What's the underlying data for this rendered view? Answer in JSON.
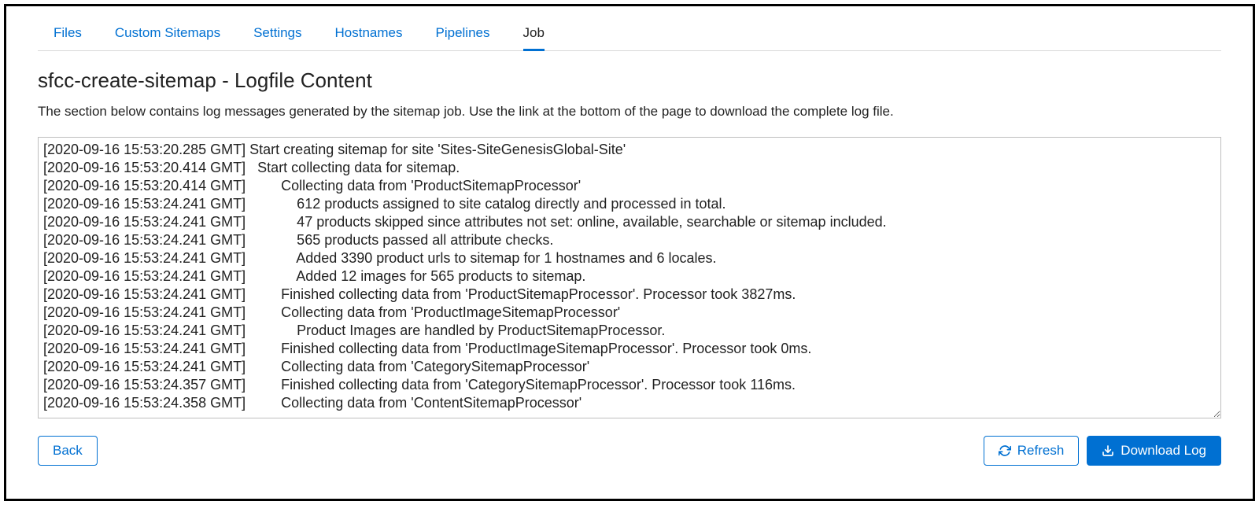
{
  "tabs": [
    {
      "label": "Files",
      "active": false
    },
    {
      "label": "Custom Sitemaps",
      "active": false
    },
    {
      "label": "Settings",
      "active": false
    },
    {
      "label": "Hostnames",
      "active": false
    },
    {
      "label": "Pipelines",
      "active": false
    },
    {
      "label": "Job",
      "active": true
    }
  ],
  "page_title": "sfcc-create-sitemap - Logfile Content",
  "description": "The section below contains log messages generated by the sitemap job. Use the link at the bottom of the page to download the complete log file.",
  "log_lines": [
    "[2020-09-16 15:53:20.285 GMT] Start creating sitemap for site 'Sites-SiteGenesisGlobal-Site'",
    "[2020-09-16 15:53:20.414 GMT]   Start collecting data for sitemap.",
    "[2020-09-16 15:53:20.414 GMT]         Collecting data from 'ProductSitemapProcessor'",
    "[2020-09-16 15:53:24.241 GMT]             612 products assigned to site catalog directly and processed in total.",
    "[2020-09-16 15:53:24.241 GMT]             47 products skipped since attributes not set: online, available, searchable or sitemap included.",
    "[2020-09-16 15:53:24.241 GMT]             565 products passed all attribute checks.",
    "[2020-09-16 15:53:24.241 GMT]             Added 3390 product urls to sitemap for 1 hostnames and 6 locales.",
    "[2020-09-16 15:53:24.241 GMT]             Added 12 images for 565 products to sitemap.",
    "[2020-09-16 15:53:24.241 GMT]         Finished collecting data from 'ProductSitemapProcessor'. Processor took 3827ms.",
    "[2020-09-16 15:53:24.241 GMT]         Collecting data from 'ProductImageSitemapProcessor'",
    "[2020-09-16 15:53:24.241 GMT]             Product Images are handled by ProductSitemapProcessor.",
    "[2020-09-16 15:53:24.241 GMT]         Finished collecting data from 'ProductImageSitemapProcessor'. Processor took 0ms.",
    "[2020-09-16 15:53:24.241 GMT]         Collecting data from 'CategorySitemapProcessor'",
    "[2020-09-16 15:53:24.357 GMT]         Finished collecting data from 'CategorySitemapProcessor'. Processor took 116ms.",
    "[2020-09-16 15:53:24.358 GMT]         Collecting data from 'ContentSitemapProcessor'"
  ],
  "buttons": {
    "back": "Back",
    "refresh": "Refresh",
    "download": "Download Log"
  }
}
